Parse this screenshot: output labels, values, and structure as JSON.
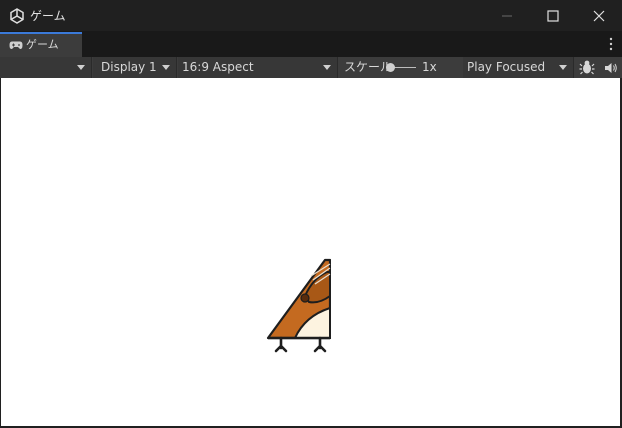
{
  "window": {
    "title": "ゲーム"
  },
  "tabs": [
    {
      "label": "ゲーム"
    }
  ],
  "toolbar": {
    "display": "Display 1",
    "aspect": "16:9 Aspect",
    "scale_label": "スケール",
    "scale_value": "1x",
    "play_mode": "Play Focused"
  },
  "icons": {
    "app": "unity-icon",
    "tab": "gamepad-icon",
    "stats": "bug-icon",
    "audio": "speaker-icon",
    "menu": "kebab-menu-icon"
  },
  "viewport": {
    "background": "#ffffff"
  }
}
